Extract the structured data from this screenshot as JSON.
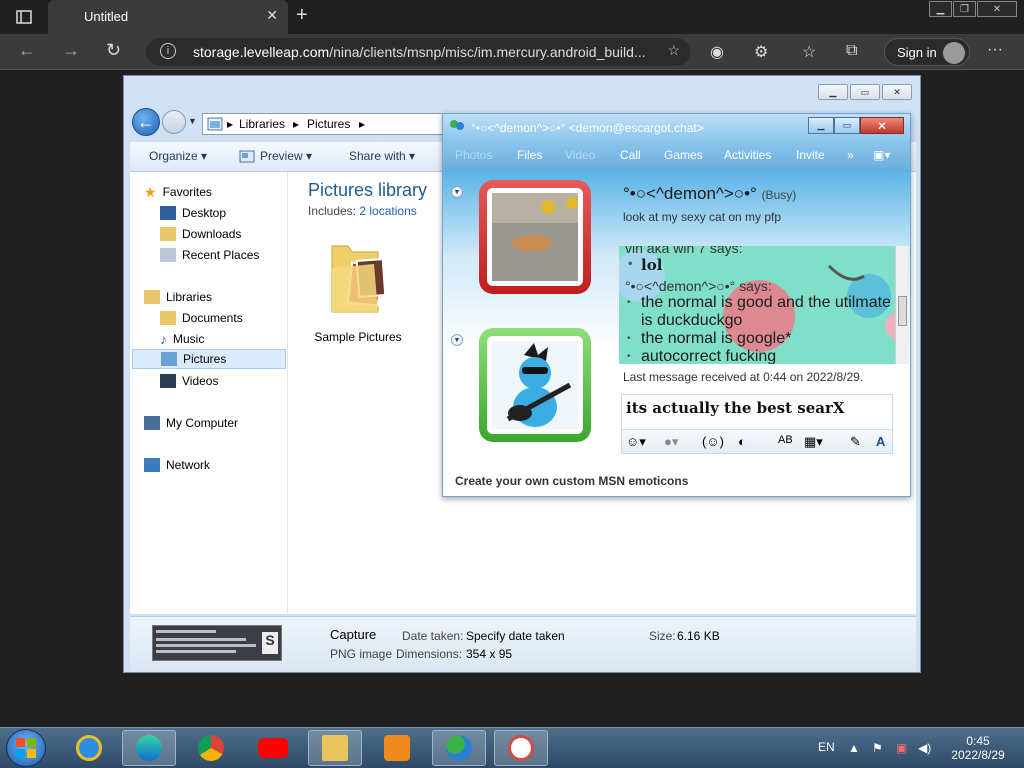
{
  "browser": {
    "tab_title": "Untitled",
    "url_host": "storage.levelleap.com",
    "url_path": "/nina/clients/msnp/misc/im.mercury.android_build...",
    "sign_in_label": "Sign in"
  },
  "explorer": {
    "breadcrumb": [
      "Libraries",
      "Pictures"
    ],
    "toolbar": {
      "organize": "Organize ▾",
      "preview": "Preview ▾",
      "share": "Share with ▾"
    },
    "nav": {
      "favorites": "Favorites",
      "desktop": "Desktop",
      "downloads": "Downloads",
      "recent": "Recent Places",
      "libraries": "Libraries",
      "documents": "Documents",
      "music": "Music",
      "pictures": "Pictures",
      "videos": "Videos",
      "computer": "My Computer",
      "network": "Network"
    },
    "library_title": "Pictures library",
    "includes_label": "Includes:",
    "includes_link": "2 locations",
    "folder_label": "Sample Pictures",
    "details": {
      "name": "Capture",
      "type": "PNG image",
      "date_label": "Date taken:",
      "date_value": "Specify date taken",
      "dims_label": "Dimensions:",
      "dims_value": "354 x 95",
      "size_label": "Size:",
      "size_value": "6.16 KB"
    }
  },
  "msn": {
    "title": "°•○<^demon^>○•° <demon@escargot.chat>",
    "menu": [
      "Photos",
      "Files",
      "Video",
      "Call",
      "Games",
      "Activities",
      "Invite",
      "»"
    ],
    "contact_name": "°•○<^demon^>○•°",
    "contact_status": "(Busy)",
    "contact_message": "look at my sexy cat on my pfp",
    "history": {
      "partial": "vin aka win 7 says:",
      "line1": "lol",
      "sender": "°•○<^demon^>○•° says:",
      "line2": "the normal is good and the utilmate is duckduckgo",
      "line3": "the normal is google*",
      "line4": "autocorrect fucking"
    },
    "last_message": "Last message received at 0:44 on 2022/8/29.",
    "compose_text": "its actually the best searX",
    "footer": "Create your own custom MSN emoticons"
  },
  "taskbar": {
    "lang": "EN",
    "time": "0:45",
    "date": "2022/8/29"
  },
  "colors": {
    "explorer_accent": "#1e5d8e",
    "msn_title": "#8ec6ec",
    "history_bg": "#7fdfc8"
  }
}
